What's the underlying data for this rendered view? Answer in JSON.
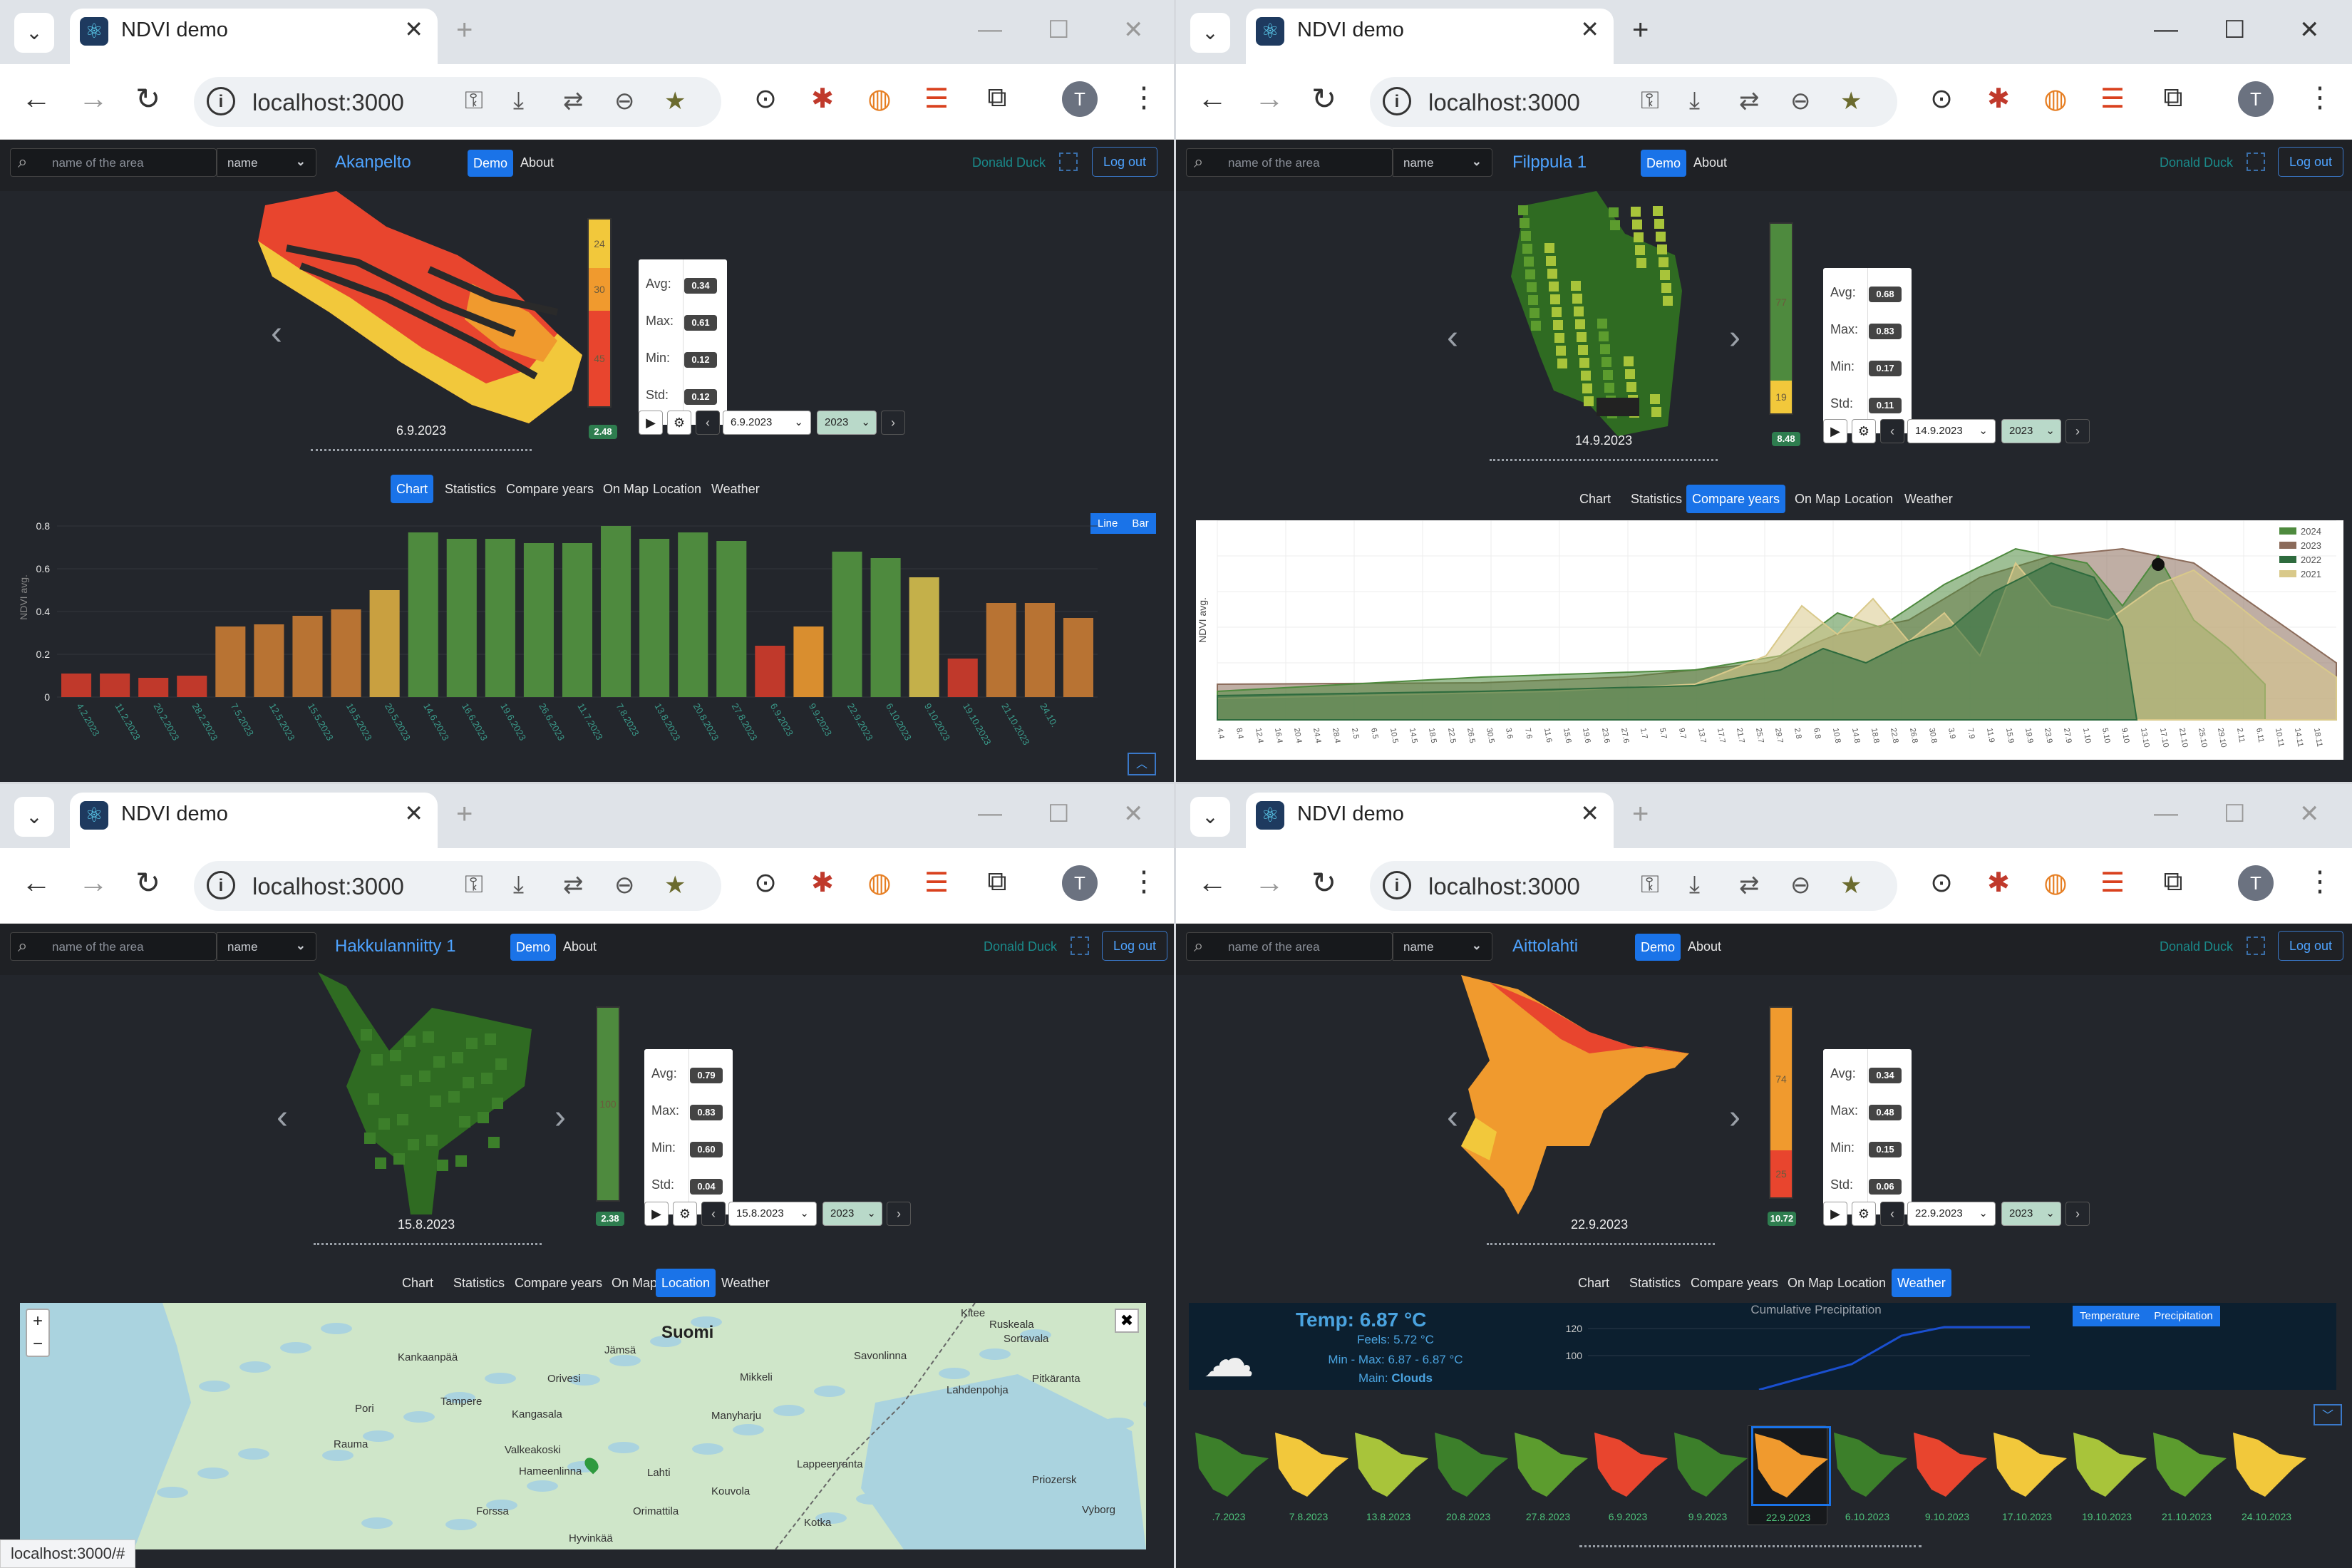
{
  "common": {
    "tab_title": "NDVI demo",
    "url": "localhost:3000",
    "search_placeholder": "name of the area",
    "select_value": "name",
    "demo": "Demo",
    "about": "About",
    "user": "Donald Duck",
    "logout": "Log out",
    "avatar_letter": "T",
    "stat_labels": [
      "Avg:",
      "Max:",
      "Min:",
      "Std:"
    ],
    "tabs": [
      "Chart",
      "Statistics",
      "Compare years",
      "On Map",
      "Location",
      "Weather"
    ]
  },
  "w1": {
    "field": "Akanpelto",
    "date": "6.9.2023",
    "date_select": "6.9.2023",
    "year": "2023",
    "stats": [
      "0.34",
      "0.61",
      "0.12",
      "0.12"
    ],
    "legend": [
      "24",
      "30",
      "45"
    ],
    "legend_badge": "2.48",
    "active_tab": "Chart",
    "chart_buttons": [
      "Line",
      "Bar"
    ]
  },
  "w2": {
    "field": "Filppula 1",
    "date": "14.9.2023",
    "date_select": "14.9.2023",
    "year": "2023",
    "stats": [
      "0.68",
      "0.83",
      "0.17",
      "0.11"
    ],
    "legend": [
      "77",
      "19"
    ],
    "legend_badge": "8.48",
    "active_tab": "Compare years"
  },
  "w3": {
    "field": "Hakkulanniitty 1",
    "date": "15.8.2023",
    "date_select": "15.8.2023",
    "year": "2023",
    "stats": [
      "0.79",
      "0.83",
      "0.60",
      "0.04"
    ],
    "legend": [
      "100"
    ],
    "legend_badge": "2.38",
    "active_tab": "Location",
    "status_url": "localhost:3000/#"
  },
  "w4": {
    "field": "Aittolahti",
    "date": "22.9.2023",
    "date_select": "22.9.2023",
    "year": "2023",
    "stats": [
      "0.34",
      "0.48",
      "0.15",
      "0.06"
    ],
    "legend": [
      "74",
      "25"
    ],
    "legend_badge": "10.72",
    "active_tab": "Weather"
  },
  "chart_data": [
    {
      "type": "bar",
      "ylabel": "NDVI avg.",
      "ylim": [
        0,
        0.8
      ],
      "yticks": [
        "0",
        "0.2",
        "0.4",
        "0.6",
        "0.8"
      ],
      "categories": [
        "4.2.2023",
        "11.2.2023",
        "20.2.2023",
        "28.2.2023",
        "7.5.2023",
        "12.5.2023",
        "15.5.2023",
        "19.5.2023",
        "20.5.2023",
        "14.6.2023",
        "16.6.2023",
        "19.6.2023",
        "26.6.2023",
        "11.7.2023",
        "7.8.2023",
        "13.8.2023",
        "20.8.2023",
        "27.8.2023",
        "6.9.2023",
        "9.9.2023",
        "22.9.2023",
        "6.10.2023",
        "9.10.2023",
        "19.10.2023",
        "21.10.2023",
        "24.10."
      ],
      "values": [
        0.11,
        0.11,
        0.09,
        0.1,
        0.33,
        0.34,
        0.38,
        0.41,
        0.5,
        0.77,
        0.74,
        0.74,
        0.72,
        0.72,
        0.8,
        0.74,
        0.77,
        0.73,
        0.24,
        0.33,
        0.68,
        0.65,
        0.56,
        0.18,
        0.44,
        0.44,
        0.37
      ],
      "colors": [
        "#c0392b",
        "#c0392b",
        "#c0392b",
        "#c0392b",
        "#b87333",
        "#b87333",
        "#b87333",
        "#b87333",
        "#c9a040",
        "#4e8a3e",
        "#4e8a3e",
        "#4e8a3e",
        "#4e8a3e",
        "#4e8a3e",
        "#4e8a3e",
        "#4e8a3e",
        "#4e8a3e",
        "#4e8a3e",
        "#c0392b",
        "#d98e2f",
        "#4e8a3e",
        "#4e8a3e",
        "#c4b04a",
        "#c0392b",
        "#b87333",
        "#b87333",
        "#b87333"
      ]
    },
    {
      "type": "area",
      "ylabel": "NDVI avg.",
      "series": [
        {
          "name": "2024",
          "color": "#4e8a3e"
        },
        {
          "name": "2023",
          "color": "#8b6b5a"
        },
        {
          "name": "2022",
          "color": "#2e6b3e"
        },
        {
          "name": "2021",
          "color": "#d9c98a"
        }
      ],
      "x": [
        "4.4",
        "8.4",
        "12.4",
        "16.4",
        "20.4",
        "24.4",
        "28.4",
        "2.5",
        "6.5",
        "10.5",
        "14.5",
        "18.5",
        "22.5",
        "26.5",
        "30.5",
        "3.6",
        "7.6",
        "11.6",
        "15.6",
        "19.6",
        "23.6",
        "27.6",
        "1.7",
        "5.7",
        "9.7",
        "13.7",
        "17.7",
        "21.7",
        "25.7",
        "29.7",
        "2.8",
        "6.8",
        "10.8",
        "14.8",
        "18.8",
        "22.8",
        "26.8",
        "30.8",
        "3.9",
        "7.9",
        "11.9",
        "15.9",
        "19.9",
        "23.9",
        "27.9",
        "1.10",
        "5.10",
        "9.10",
        "13.10",
        "17.10",
        "21.10",
        "25.10",
        "29.10",
        "2.11",
        "6.11",
        "10.11",
        "14.11",
        "18.11"
      ]
    }
  ],
  "map": {
    "labels": [
      "Suomi",
      "Tampere",
      "Pori",
      "Rauma",
      "Kangasala",
      "Valkeakoski",
      "Hameenlinna",
      "Lahti",
      "Kouvola",
      "Lappeenranta",
      "Mikkeli",
      "Savonlinna",
      "Jämsä",
      "Orivesi",
      "Kankaanpää",
      "Forssa",
      "Orimattila",
      "Hyvinkää",
      "Kotka",
      "Kitee",
      "Ruskeala",
      "Sortavala",
      "Pitkäranta",
      "Lahdenpohja",
      "Manyharju",
      "Priozersk",
      "Vyborg"
    ],
    "zoom_in": "+",
    "zoom_out": "−"
  },
  "weather": {
    "temp": "Temp: 6.87 °C",
    "feels": "Feels: 5.72 °C",
    "minmax": "Min - Max: 6.87 - 6.87 °C",
    "main_label": "Main:",
    "main": "Clouds",
    "chart_title": "Cumulative Precipitation",
    "yticks": [
      "120",
      "100"
    ],
    "buttons": [
      "Temperature",
      "Precipitation"
    ],
    "thumbs": [
      ".7.2023",
      "7.8.2023",
      "13.8.2023",
      "20.8.2023",
      "27.8.2023",
      "6.9.2023",
      "9.9.2023",
      "22.9.2023",
      "6.10.2023",
      "9.10.2023",
      "17.10.2023",
      "19.10.2023",
      "21.10.2023",
      "24.10.2023"
    ],
    "selected_index": 7
  }
}
